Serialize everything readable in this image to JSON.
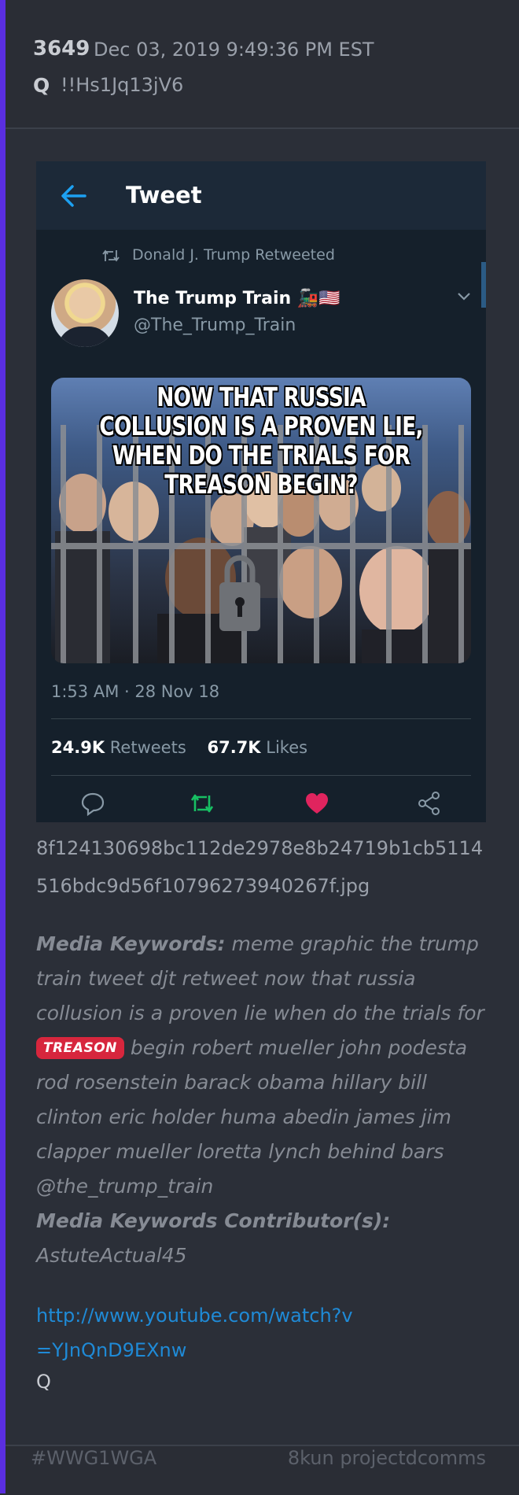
{
  "post": {
    "number": "3649",
    "date": "Dec 03, 2019 9:49:36 PM EST",
    "q_label": "Q",
    "tripcode": "!!Hs1Jq13jV6"
  },
  "tweet": {
    "header_title": "Tweet",
    "retweet_label": "Donald J. Trump Retweeted",
    "display_name": "The Trump Train 🚂🇺🇸",
    "handle": "@The_Trump_Train",
    "meme_text": "NOW THAT RUSSIA COLLUSION IS A PROVEN LIE, WHEN DO THE TRIALS FOR TREASON BEGIN?",
    "timestamp": "1:53 AM · 28 Nov 18",
    "retweets_count": "24.9K",
    "retweets_label": "Retweets",
    "likes_count": "67.7K",
    "likes_label": "Likes",
    "colors": {
      "accent": "#1da1f2",
      "retweet": "#17bf63",
      "like": "#e0245e"
    }
  },
  "file": {
    "name_line1": "8f124130698bc112de2978e8b24719b1cb5114",
    "name_line2": "516bdc9d56f10796273940267f.jpg"
  },
  "keywords": {
    "label": "Media Keywords:",
    "text_before": "meme graphic the trump train tweet djt retweet now that russia collusion is a proven lie when do the trials for",
    "badge": "TREASON",
    "text_after": "begin robert mueller john podesta rod rosenstein barack obama hillary bill clinton eric holder huma abedin james jim clapper mueller loretta lynch behind bars @the_trump_train",
    "contributor_label": "Media Keywords Contributor(s):",
    "contributor": "AstuteActual45"
  },
  "link": "http://www.youtube.com/watch?v=YJnQnD9EXnw",
  "signature": "Q",
  "footer": {
    "tag": "#WWG1WGA",
    "source": "8kun projectdcomms"
  }
}
